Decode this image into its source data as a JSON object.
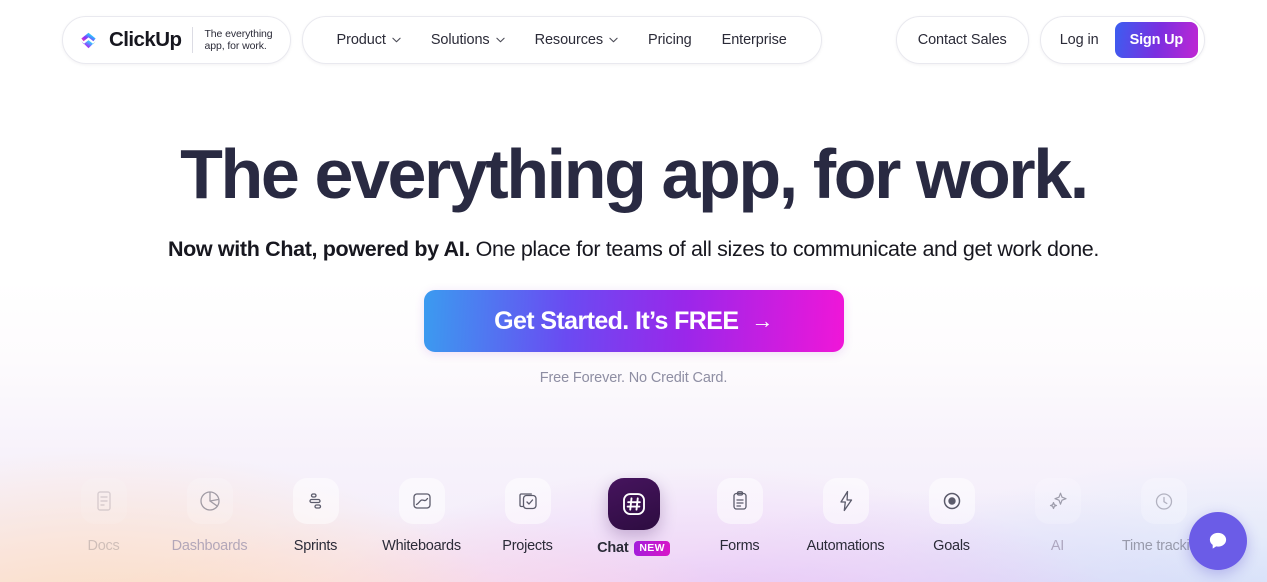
{
  "header": {
    "logo": {
      "wordmark": "ClickUp",
      "tagline": "The everything\napp, for work.",
      "icon": "clickup-logo-mark"
    },
    "nav": [
      {
        "label": "Product",
        "caret": true
      },
      {
        "label": "Solutions",
        "caret": true
      },
      {
        "label": "Resources",
        "caret": true
      },
      {
        "label": "Pricing",
        "caret": false
      },
      {
        "label": "Enterprise",
        "caret": false
      }
    ],
    "contact_sales_label": "Contact Sales",
    "login_label": "Log in",
    "signup_label": "Sign Up",
    "signup_gradient": [
      "#3b5ef0",
      "#c026d3"
    ]
  },
  "hero": {
    "headline": "The everything app, for work.",
    "subhead_bold": "Now with Chat, powered by AI.",
    "subhead_rest": " One place for teams of all sizes to communicate and get work done.",
    "cta_label": "Get Started. It’s FREE",
    "cta_arrow": "→",
    "cta_note": "Free Forever. No Credit Card.",
    "headline_color": "#292a42",
    "cta_gradient": [
      "#3b9bf0",
      "#f016d8"
    ]
  },
  "carousel": {
    "items": [
      {
        "label": "Docs",
        "icon": "docs-icon",
        "state": "faintest"
      },
      {
        "label": "Dashboards",
        "icon": "pie-chart-icon",
        "state": "dim"
      },
      {
        "label": "Sprints",
        "icon": "sprints-bars-icon",
        "state": "normal"
      },
      {
        "label": "Whiteboards",
        "icon": "whiteboard-icon",
        "state": "normal"
      },
      {
        "label": "Projects",
        "icon": "projects-check-icon",
        "state": "normal"
      },
      {
        "label": "Chat",
        "icon": "chat-hash-icon",
        "state": "active",
        "badge": "NEW"
      },
      {
        "label": "Forms",
        "icon": "forms-clipboard-icon",
        "state": "normal"
      },
      {
        "label": "Automations",
        "icon": "lightning-bolt-icon",
        "state": "normal"
      },
      {
        "label": "Goals",
        "icon": "goals-target-icon",
        "state": "normal"
      },
      {
        "label": "AI",
        "icon": "ai-sparkle-icon",
        "state": "dim"
      },
      {
        "label": "Time tracking",
        "icon": "time-tracking-icon",
        "state": "faint"
      }
    ],
    "active_tile_color": "#3b1050",
    "badge_gradient": [
      "#a21ddb",
      "#d916c8"
    ]
  },
  "chat_widget": {
    "icon": "chat-bubble-icon",
    "color": "#6b5ce7"
  }
}
